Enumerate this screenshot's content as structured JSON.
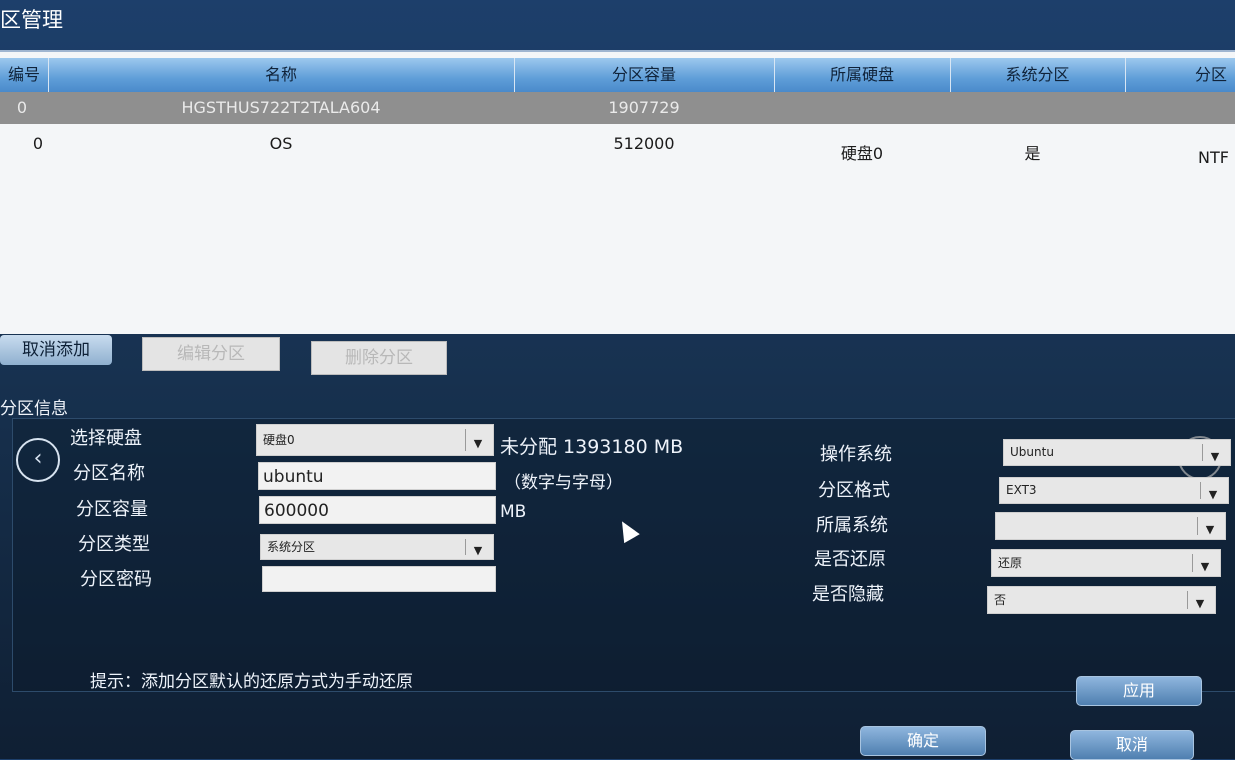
{
  "window": {
    "title": "区管理"
  },
  "table": {
    "headers": [
      "编号",
      "名称",
      "分区容量",
      "所属硬盘",
      "系统分区",
      "分区"
    ],
    "rows": [
      {
        "no": "0",
        "name": "HGSTHUS722T2TALA604",
        "capacity": "1907729",
        "disk": "",
        "system": "",
        "format": ""
      },
      {
        "no": "0",
        "name": "OS",
        "capacity": "512000",
        "disk": "硬盘0",
        "system": "是",
        "format": "NTF"
      }
    ]
  },
  "toolbar": {
    "cancel_add": "取消添加",
    "edit_partition": "编辑分区",
    "delete_partition": "删除分区"
  },
  "info": {
    "section_title": "分区信息",
    "disk_label": "选择硬盘",
    "disk_value": "硬盘0",
    "unallocated": "未分配 1393180 MB",
    "name_label": "分区名称",
    "name_value": "ubuntu",
    "name_hint": "（数字与字母）",
    "size_label": "分区容量",
    "size_value": "600000",
    "size_unit": "MB",
    "type_label": "分区类型",
    "type_value": "系统分区",
    "password_label": "分区密码",
    "password_value": "",
    "os_label": "操作系统",
    "os_value": "Ubuntu",
    "format_label": "分区格式",
    "format_value": "EXT3",
    "belongs_label": "所属系统",
    "belongs_value": "",
    "restore_label": "是否还原",
    "restore_value": "还原",
    "hidden_label": "是否隐藏",
    "hidden_value": "否",
    "tip": "提示：添加分区默认的还原方式为手动还原"
  },
  "buttons": {
    "apply": "应用",
    "ok": "确定",
    "cancel": "取消"
  },
  "icons": {
    "prev": "chevron-left-icon",
    "next": "chevron-right-icon",
    "cursor": "mouse-pointer-icon",
    "dropdown": "chevron-down-icon"
  }
}
